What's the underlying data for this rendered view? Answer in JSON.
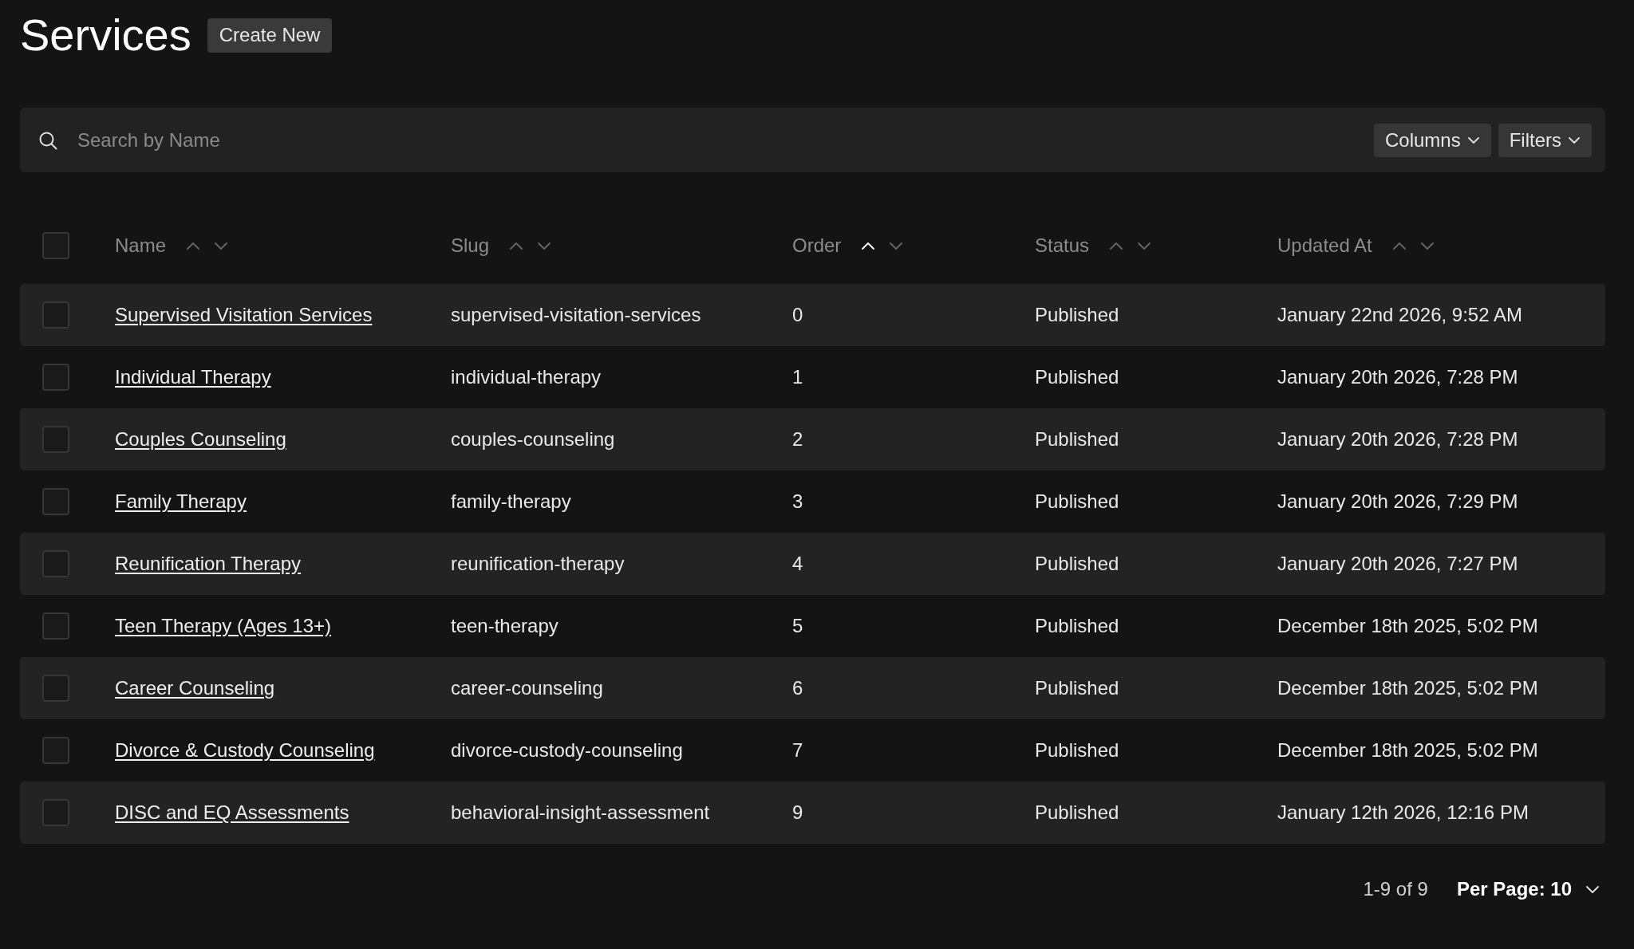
{
  "header": {
    "title": "Services",
    "create_button": "Create New"
  },
  "toolbar": {
    "search": {
      "placeholder": "Search by Name"
    },
    "buttons": [
      "Columns",
      "Filters"
    ]
  },
  "table": {
    "select_all": {
      "checked": false
    },
    "columns": [
      {
        "label": "Name",
        "sorted_ascending": false
      },
      {
        "label": "Slug",
        "sorted_ascending": false
      },
      {
        "label": "Order",
        "sorted_ascending": true
      },
      {
        "label": "Status",
        "sorted_ascending": false
      },
      {
        "label": "Updated At",
        "sorted_ascending": false
      }
    ],
    "rows": [
      {
        "checked": false,
        "name": "Supervised Visitation Services",
        "slug": "supervised-visitation-services",
        "order": "0",
        "status": "Published",
        "updated_at": "January 22nd 2026, 9:52 AM"
      },
      {
        "checked": false,
        "name": "Individual Therapy",
        "slug": "individual-therapy",
        "order": "1",
        "status": "Published",
        "updated_at": "January 20th 2026, 7:28 PM"
      },
      {
        "checked": false,
        "name": "Couples Counseling",
        "slug": "couples-counseling",
        "order": "2",
        "status": "Published",
        "updated_at": "January 20th 2026, 7:28 PM"
      },
      {
        "checked": false,
        "name": "Family Therapy",
        "slug": "family-therapy",
        "order": "3",
        "status": "Published",
        "updated_at": "January 20th 2026, 7:29 PM"
      },
      {
        "checked": false,
        "name": "Reunification Therapy",
        "slug": "reunification-therapy",
        "order": "4",
        "status": "Published",
        "updated_at": "January 20th 2026, 7:27 PM"
      },
      {
        "checked": false,
        "name": "Teen Therapy (Ages 13+)",
        "slug": "teen-therapy",
        "order": "5",
        "status": "Published",
        "updated_at": "December 18th 2025, 5:02 PM"
      },
      {
        "checked": false,
        "name": "Career Counseling",
        "slug": "career-counseling",
        "order": "6",
        "status": "Published",
        "updated_at": "December 18th 2025, 5:02 PM"
      },
      {
        "checked": false,
        "name": "Divorce & Custody Counseling",
        "slug": "divorce-custody-counseling",
        "order": "7",
        "status": "Published",
        "updated_at": "December 18th 2025, 5:02 PM"
      },
      {
        "checked": false,
        "name": "DISC and EQ Assessments",
        "slug": "behavioral-insight-assessment",
        "order": "9",
        "status": "Published",
        "updated_at": "January 12th 2026, 12:16 PM"
      }
    ]
  },
  "pagination": {
    "range": "1-9 of 9",
    "per_page": "Per Page: 10"
  }
}
